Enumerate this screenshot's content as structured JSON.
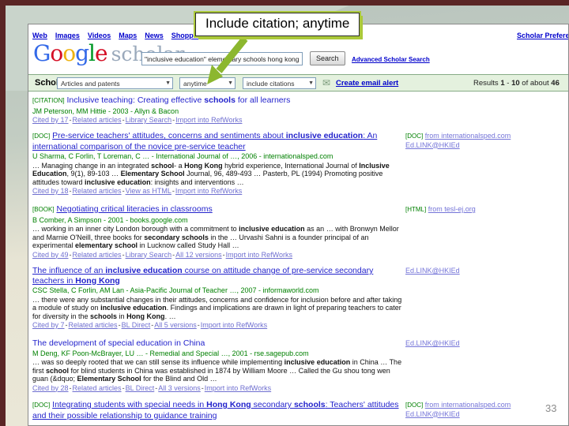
{
  "slide": {
    "page_number": "33",
    "callout_text": "Include citation; anytime"
  },
  "icons": {
    "envelope": "✉",
    "dropdown_arrow": "▼"
  },
  "header": {
    "nav_links": [
      "Web",
      "Images",
      "Videos",
      "Maps",
      "News",
      "Shopping"
    ],
    "preferences_link": "Scholar Preferences",
    "logo": {
      "letters": [
        "G",
        "o",
        "o",
        "g",
        "l",
        "e"
      ],
      "colors": [
        "#3369e8",
        "#d50f25",
        "#eeb211",
        "#3369e8",
        "#009925",
        "#d50f25"
      ],
      "scholar": "scholar"
    },
    "search": {
      "value": "\"inclusive education\" elementary schools hong kong",
      "button": "Search",
      "advanced_link": "Advanced Scholar Search"
    }
  },
  "toolbar": {
    "label": "Scholar",
    "dropdown_articles": "Articles and patents",
    "dropdown_time": "anytime",
    "dropdown_citations": "include citations",
    "alert_link": "Create email alert",
    "results_text": "Results **1** - **10** of about **46**"
  },
  "results": [
    {
      "tag": "[CITATION]",
      "title": "Inclusive teaching: Creating effective **schools** for all learners",
      "authors": "JM Peterson, MM Hittie - 2003 - Allyn & Bacon",
      "links": [
        "Cited by 17",
        "Related articles",
        "Library Search",
        "Import into RefWorks"
      ]
    },
    {
      "tag": "[DOC]",
      "title": "Pre-service teachers' attitudes, concerns and sentiments about **inclusive education**: An international comparison of the novice pre-service teacher",
      "authors": "U Sharma, C Forlin, T Loreman, C … - International Journal of …, 2006 - internationalsped.com",
      "snippet": "… Managing change in an integrated **school**- a **Hong Kong** hybrid experience, International Journal of **Inclusive Education**, 9(1), 89-103 … **Elementary School** Journal, 96, 489-493 … Pasterb, PL (1994) Promoting positive attitudes toward **inclusive education**: insights and interventions …",
      "links": [
        "Cited by 18",
        "Related articles",
        "View as HTML",
        "Import into RefWorks"
      ],
      "side_tag": "[DOC]",
      "side_link": "from internationalsped.com",
      "side_link2": "Ed.LINK@HKIEd"
    },
    {
      "tag": "[BOOK]",
      "title": "Negotiating critical literacies in classrooms",
      "authors": "B Comber, A Simpson - 2001 - books.google.com",
      "snippet": "… working in an inner city London borough with a commitment to **inclusive education** as an … with Bronwyn Mellor and Marnie O'Neill, three books for **secondary schools** in the … Urvashi Sahni is a founder principal of an experimental **elementary school** in Lucknow called Study Hall …",
      "links": [
        "Cited by 49",
        "Related articles",
        "Library Search",
        "All 12 versions",
        "Import into RefWorks"
      ],
      "side_tag": "[HTML]",
      "side_link": "from tesl-ej.org"
    },
    {
      "title": "The influence of an **inclusive education** course on attitude change of pre-service secondary teachers in **Hong Kong**",
      "authors": "CSC Stella, C Forlin, AM Lan - Asia-Pacific Journal of Teacher …, 2007 - informaworld.com",
      "snippet": "… there were any substantial changes in their attitudes, concerns and confidence for inclusion before and after taking a module of study on **inclusive education**. Findings and implications are drawn in light of preparing teachers to cater for diversity in the **schools** in **Hong Kong**. …",
      "links": [
        "Cited by 7",
        "Related articles",
        "BL Direct",
        "All 5 versions",
        "Import into RefWorks"
      ],
      "side_link2": "Ed.LINK@HKIEd"
    },
    {
      "title": "The development of special education in China",
      "authors": "M Deng, KF Poon-McBrayer, LU … - Remedial and Special …, 2001 - rse.sagepub.com",
      "snippet": "… was so deeply rooted that we can still sense its influence while implementing **inclusive education** in China … The first **school** for blind students in China was established in 1874 by William Moore … Called the Gu shou tong wen guan (&dquo; **Elementary School** for the Blind and Old …",
      "links": [
        "Cited by 28",
        "Related articles",
        "BL Direct",
        "All 3 versions",
        "Import into RefWorks"
      ],
      "side_link2": "Ed.LINK@HKIEd"
    },
    {
      "tag": "[DOC]",
      "title": "Integrating students with special needs in **Hong Kong** secondary **schools**: Teachers' attitudes and their possible relationship to guidance training",
      "side_tag": "[DOC]",
      "side_link": "from internationalsped.com",
      "side_link2": "Ed.LINK@HKIEd"
    }
  ]
}
